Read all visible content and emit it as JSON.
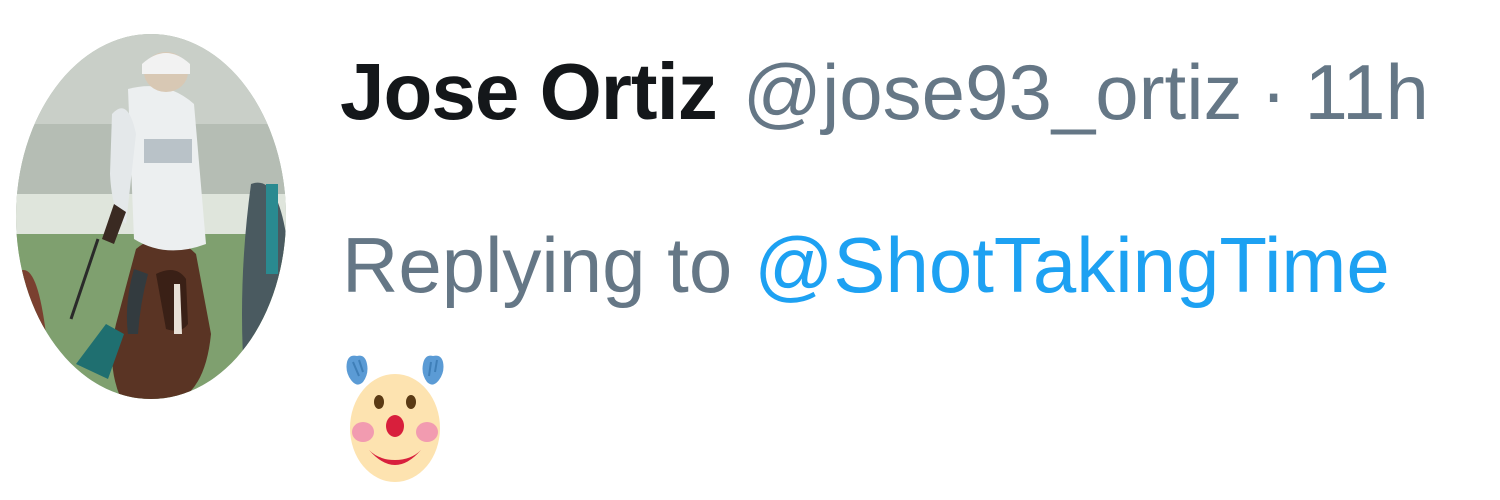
{
  "tweet": {
    "author": {
      "display_name": "Jose Ortiz",
      "handle": "@jose93_ortiz",
      "avatar_icon": "jockey-on-horse-avatar"
    },
    "separator": "·",
    "timestamp": "11h",
    "reply": {
      "prefix": "Replying to",
      "mention": "@ShotTakingTime"
    },
    "content": {
      "emoji": "clown-face-emoji"
    }
  },
  "colors": {
    "name": "#14171a",
    "muted": "#657786",
    "link": "#1da1f2",
    "background": "#ffffff"
  }
}
